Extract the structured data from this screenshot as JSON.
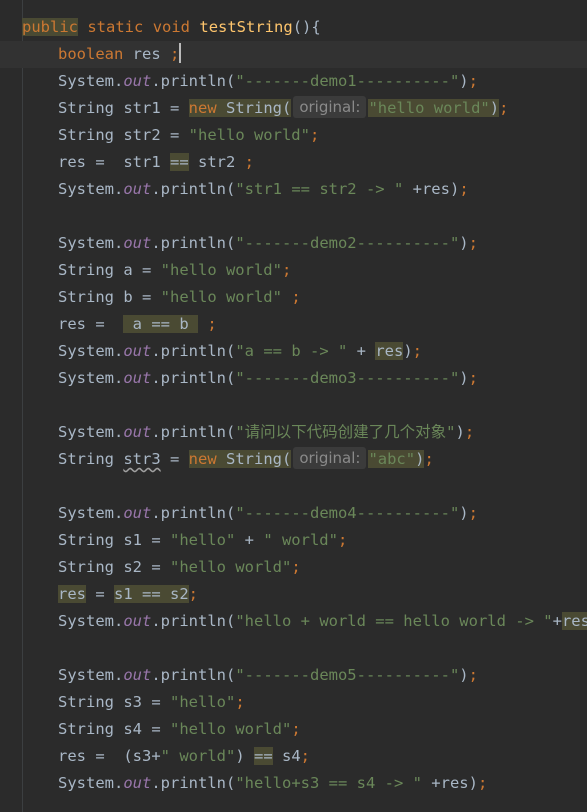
{
  "editor": {
    "colors": {
      "background": "#2b2b2b",
      "current_line": "#323232",
      "keyword": "#cc7832",
      "method": "#ffc66d",
      "string": "#6a8759",
      "static_field": "#9876aa",
      "text": "#a9b7c6",
      "highlight": "#4a4a33",
      "hint_text": "#8a8a8a"
    },
    "lines": [
      {
        "indent": 0,
        "tokens": [
          {
            "t": "public",
            "c": "kw",
            "hl": true
          },
          {
            "t": " "
          },
          {
            "t": "static",
            "c": "kw"
          },
          {
            "t": " "
          },
          {
            "t": "void",
            "c": "kw"
          },
          {
            "t": " "
          },
          {
            "t": "testString",
            "c": "fn"
          },
          {
            "t": "(){"
          }
        ]
      },
      {
        "indent": 1,
        "current": true,
        "tokens": [
          {
            "t": "boolean",
            "c": "kw"
          },
          {
            "t": " res "
          },
          {
            "t": ";",
            "c": "kw"
          },
          {
            "caret": true
          }
        ]
      },
      {
        "indent": 1,
        "tokens": [
          {
            "t": "System."
          },
          {
            "t": "out",
            "c": "static-field"
          },
          {
            "t": ".println("
          },
          {
            "t": "\"-------demo1----------\"",
            "c": "str"
          },
          {
            "t": ")"
          },
          {
            "t": ";",
            "c": "kw"
          }
        ]
      },
      {
        "indent": 1,
        "tokens": [
          {
            "t": "String str1 = "
          },
          {
            "t": "new",
            "c": "kw",
            "hl": true
          },
          {
            "t": " String(",
            "hl": true
          },
          {
            "hint": "original:",
            "hl": true
          },
          {
            "t": "\"hello world\"",
            "c": "str",
            "hl": true
          },
          {
            "t": ")",
            "hl": true
          },
          {
            "t": ";",
            "c": "kw"
          }
        ]
      },
      {
        "indent": 1,
        "tokens": [
          {
            "t": "String str2 = "
          },
          {
            "t": "\"hello world\"",
            "c": "str"
          },
          {
            "t": ";",
            "c": "kw"
          }
        ]
      },
      {
        "indent": 1,
        "tokens": [
          {
            "t": "res =  str1 "
          },
          {
            "t": "==",
            "hl": true
          },
          {
            "t": " str2 "
          },
          {
            "t": ";",
            "c": "kw"
          }
        ]
      },
      {
        "indent": 1,
        "tokens": [
          {
            "t": "System."
          },
          {
            "t": "out",
            "c": "static-field"
          },
          {
            "t": ".println("
          },
          {
            "t": "\"str1 == str2 -> \"",
            "c": "str"
          },
          {
            "t": " +res)"
          },
          {
            "t": ";",
            "c": "kw"
          }
        ]
      },
      {
        "indent": 1,
        "tokens": []
      },
      {
        "indent": 1,
        "tokens": [
          {
            "t": "System."
          },
          {
            "t": "out",
            "c": "static-field"
          },
          {
            "t": ".println("
          },
          {
            "t": "\"-------demo2----------\"",
            "c": "str"
          },
          {
            "t": ")"
          },
          {
            "t": ";",
            "c": "kw"
          }
        ]
      },
      {
        "indent": 1,
        "tokens": [
          {
            "t": "String a = "
          },
          {
            "t": "\"hello world\"",
            "c": "str"
          },
          {
            "t": ";",
            "c": "kw"
          }
        ]
      },
      {
        "indent": 1,
        "tokens": [
          {
            "t": "String b = "
          },
          {
            "t": "\"hello world\"",
            "c": "str"
          },
          {
            "t": " "
          },
          {
            "t": ";",
            "c": "kw"
          }
        ]
      },
      {
        "indent": 1,
        "tokens": [
          {
            "t": "res =  "
          },
          {
            "t": " a == b ",
            "hl": true
          },
          {
            "t": " "
          },
          {
            "t": ";",
            "c": "kw"
          }
        ]
      },
      {
        "indent": 1,
        "tokens": [
          {
            "t": "System."
          },
          {
            "t": "out",
            "c": "static-field"
          },
          {
            "t": ".println("
          },
          {
            "t": "\"a == b -> \"",
            "c": "str"
          },
          {
            "t": " + "
          },
          {
            "t": "res",
            "hl": true
          },
          {
            "t": ")"
          },
          {
            "t": ";",
            "c": "kw"
          }
        ]
      },
      {
        "indent": 1,
        "tokens": [
          {
            "t": "System."
          },
          {
            "t": "out",
            "c": "static-field"
          },
          {
            "t": ".println("
          },
          {
            "t": "\"-------demo3----------\"",
            "c": "str"
          },
          {
            "t": ")"
          },
          {
            "t": ";",
            "c": "kw"
          }
        ]
      },
      {
        "indent": 1,
        "tokens": []
      },
      {
        "indent": 1,
        "tokens": [
          {
            "t": "System."
          },
          {
            "t": "out",
            "c": "static-field"
          },
          {
            "t": ".println("
          },
          {
            "t": "\"请问以下代码创建了几个对象\"",
            "c": "str"
          },
          {
            "t": ")"
          },
          {
            "t": ";",
            "c": "kw"
          }
        ]
      },
      {
        "indent": 1,
        "tokens": [
          {
            "t": "String "
          },
          {
            "t": "str3",
            "warn": true
          },
          {
            "t": " = "
          },
          {
            "t": "new",
            "c": "kw",
            "hl": true
          },
          {
            "t": " String(",
            "hl": true
          },
          {
            "hint": "original:",
            "hl": true
          },
          {
            "t": "\"abc\"",
            "c": "str",
            "hl": true
          },
          {
            "t": ")",
            "hl": true
          },
          {
            "t": ";",
            "c": "kw"
          }
        ]
      },
      {
        "indent": 1,
        "tokens": []
      },
      {
        "indent": 1,
        "tokens": [
          {
            "t": "System."
          },
          {
            "t": "out",
            "c": "static-field"
          },
          {
            "t": ".println("
          },
          {
            "t": "\"-------demo4----------\"",
            "c": "str"
          },
          {
            "t": ")"
          },
          {
            "t": ";",
            "c": "kw"
          }
        ]
      },
      {
        "indent": 1,
        "tokens": [
          {
            "t": "String s1 = "
          },
          {
            "t": "\"hello\"",
            "c": "str"
          },
          {
            "t": " + "
          },
          {
            "t": "\" world\"",
            "c": "str"
          },
          {
            "t": ";",
            "c": "kw"
          }
        ]
      },
      {
        "indent": 1,
        "tokens": [
          {
            "t": "String s2 = "
          },
          {
            "t": "\"hello world\"",
            "c": "str"
          },
          {
            "t": ";",
            "c": "kw"
          }
        ]
      },
      {
        "indent": 1,
        "tokens": [
          {
            "t": "res",
            "hl": true
          },
          {
            "t": " = "
          },
          {
            "t": "s1 == s2",
            "hl": true
          },
          {
            "t": ";",
            "c": "kw"
          }
        ]
      },
      {
        "indent": 1,
        "tokens": [
          {
            "t": "System."
          },
          {
            "t": "out",
            "c": "static-field"
          },
          {
            "t": ".println("
          },
          {
            "t": "\"hello + world == hello world -> \"",
            "c": "str"
          },
          {
            "t": "+"
          },
          {
            "t": "res",
            "hl": true
          },
          {
            "t": ")"
          },
          {
            "t": ";",
            "c": "kw"
          }
        ]
      },
      {
        "indent": 1,
        "tokens": []
      },
      {
        "indent": 1,
        "tokens": [
          {
            "t": "System."
          },
          {
            "t": "out",
            "c": "static-field"
          },
          {
            "t": ".println("
          },
          {
            "t": "\"-------demo5----------\"",
            "c": "str"
          },
          {
            "t": ")"
          },
          {
            "t": ";",
            "c": "kw"
          }
        ]
      },
      {
        "indent": 1,
        "tokens": [
          {
            "t": "String s3 = "
          },
          {
            "t": "\"hello\"",
            "c": "str"
          },
          {
            "t": ";",
            "c": "kw"
          }
        ]
      },
      {
        "indent": 1,
        "tokens": [
          {
            "t": "String s4 = "
          },
          {
            "t": "\"hello world\"",
            "c": "str"
          },
          {
            "t": ";",
            "c": "kw"
          }
        ]
      },
      {
        "indent": 1,
        "tokens": [
          {
            "t": "res =  (s3+"
          },
          {
            "t": "\" world\"",
            "c": "str"
          },
          {
            "t": ") "
          },
          {
            "t": "==",
            "hl": true
          },
          {
            "t": " s4"
          },
          {
            "t": ";",
            "c": "kw"
          }
        ]
      },
      {
        "indent": 1,
        "tokens": [
          {
            "t": "System."
          },
          {
            "t": "out",
            "c": "static-field"
          },
          {
            "t": ".println("
          },
          {
            "t": "\"hello+s3 == s4 -> \"",
            "c": "str"
          },
          {
            "t": " +res)"
          },
          {
            "t": ";",
            "c": "kw"
          }
        ]
      }
    ]
  }
}
